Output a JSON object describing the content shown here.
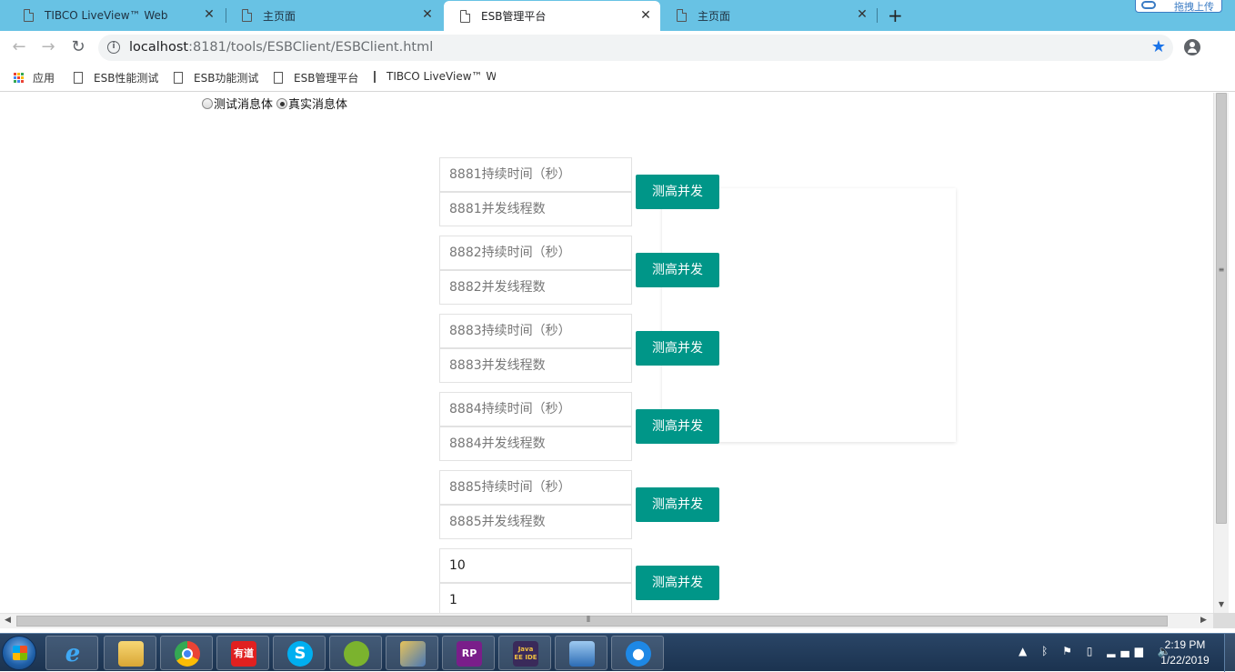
{
  "browser": {
    "tabs": [
      {
        "title": "TIBCO LiveView™ Web",
        "active": false
      },
      {
        "title": "主页面",
        "active": false
      },
      {
        "title": "ESB管理平台",
        "active": true
      },
      {
        "title": "主页面",
        "active": false
      }
    ],
    "new_tab_label": "+",
    "close_glyph": "✕",
    "widget_label": "拖拽上传",
    "url_host": "localhost",
    "url_rest": ":8181/tools/ESBClient/ESBClient.html",
    "bookmarks": [
      "应用",
      "ESB性能测试",
      "ESB功能测试",
      "ESB管理平台",
      "TIBCO LiveView™ W"
    ]
  },
  "page": {
    "radio_options": [
      {
        "label": "测试消息体",
        "checked": false
      },
      {
        "label": "真实消息体",
        "checked": true
      }
    ],
    "groups": [
      {
        "duration_placeholder": "8881持续时间（秒）",
        "threads_placeholder": "8881并发线程数",
        "duration_value": "",
        "threads_value": "",
        "button": "测高并发"
      },
      {
        "duration_placeholder": "8882持续时间（秒）",
        "threads_placeholder": "8882并发线程数",
        "duration_value": "",
        "threads_value": "",
        "button": "测高并发"
      },
      {
        "duration_placeholder": "8883持续时间（秒）",
        "threads_placeholder": "8883并发线程数",
        "duration_value": "",
        "threads_value": "",
        "button": "测高并发"
      },
      {
        "duration_placeholder": "8884持续时间（秒）",
        "threads_placeholder": "8884并发线程数",
        "duration_value": "",
        "threads_value": "",
        "button": "测高并发"
      },
      {
        "duration_placeholder": "8885持续时间（秒）",
        "threads_placeholder": "8885并发线程数",
        "duration_value": "",
        "threads_value": "",
        "button": "测高并发"
      },
      {
        "duration_placeholder": "",
        "threads_placeholder": "",
        "duration_value": "10",
        "threads_value": "1",
        "button": "测高并发"
      }
    ],
    "accent_color": "#009688"
  },
  "taskbar": {
    "apps": [
      "internet-explorer",
      "file-explorer",
      "chrome",
      "youdao",
      "skype",
      "wechat",
      "tools",
      "axure-rp",
      "java-ee-ide",
      "remote-desktop",
      "maps-pin"
    ],
    "youdao_label": "有道",
    "axure_label": "RP",
    "ide_label": "Java EE IDE",
    "clock_time": "2:19 PM",
    "clock_date": "1/22/2019"
  }
}
